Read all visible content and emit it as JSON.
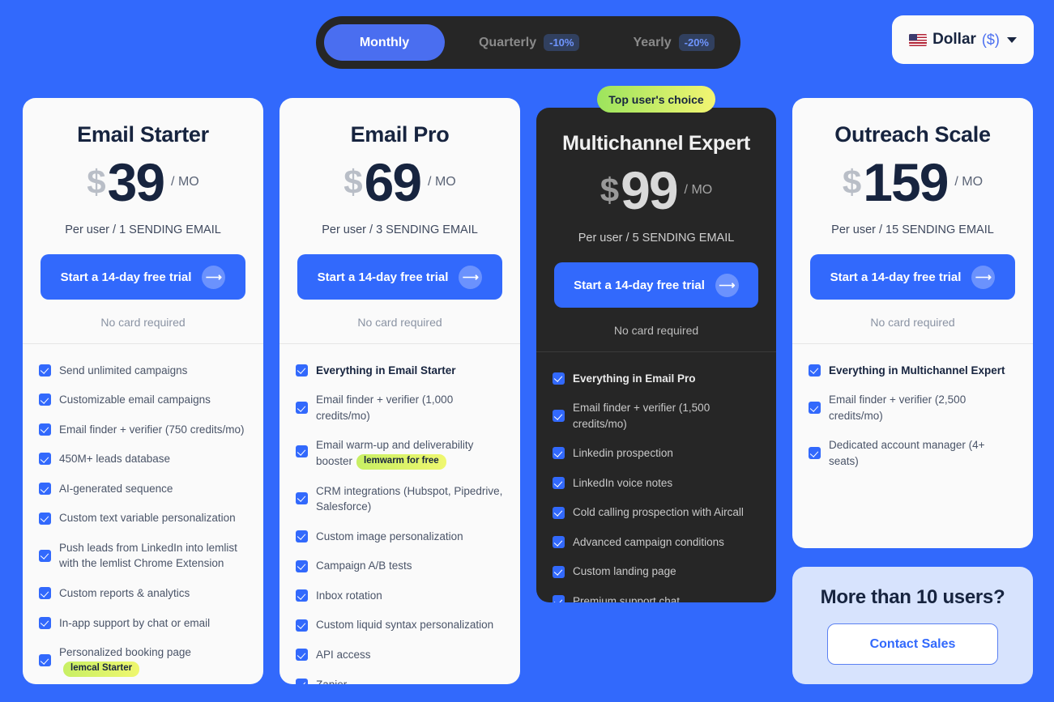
{
  "theme": {
    "background": "#3269fc",
    "card_bg": "#fafafa",
    "dark_card_bg": "#262626",
    "accent": "#3269fc",
    "badge_gradient_from": "#9ce45d",
    "badge_gradient_to": "#f3f572"
  },
  "billing_toggle": {
    "options": [
      {
        "label": "Monthly",
        "badge": "",
        "active": true
      },
      {
        "label": "Quarterly",
        "badge": "-10%",
        "active": false
      },
      {
        "label": "Yearly",
        "badge": "-20%",
        "active": false
      }
    ]
  },
  "currency_selector": {
    "flag": "us-flag-icon",
    "name": "Dollar",
    "symbol": "($)",
    "caret": "chevron-down-icon"
  },
  "top_choice_badge": "Top user's choice",
  "common": {
    "cta_label": "Start a 14-day free trial",
    "cta_arrow": "arrow-right-icon",
    "no_card": "No card required"
  },
  "plans": [
    {
      "name": "Email Starter",
      "currency_mark": "$",
      "amount": "39",
      "period": "/ MO",
      "subline": "Per user / 1 SENDING EMAIL",
      "cta": "Start a 14-day free trial",
      "no_card": "No card required",
      "features": [
        {
          "text": "Send unlimited campaigns",
          "bold": false,
          "tag": ""
        },
        {
          "text": "Customizable email campaigns",
          "bold": false,
          "tag": ""
        },
        {
          "text": "Email finder + verifier (750 credits/mo)",
          "bold": false,
          "tag": ""
        },
        {
          "text": "450M+ leads database",
          "bold": false,
          "tag": ""
        },
        {
          "text": "AI-generated sequence",
          "bold": false,
          "tag": ""
        },
        {
          "text": "Custom text variable personalization",
          "bold": false,
          "tag": ""
        },
        {
          "text": "Push leads from LinkedIn into lemlist with the lemlist Chrome Extension",
          "bold": false,
          "tag": ""
        },
        {
          "text": "Custom reports & analytics",
          "bold": false,
          "tag": ""
        },
        {
          "text": "In-app support by chat or email",
          "bold": false,
          "tag": ""
        },
        {
          "text": "Personalized booking page",
          "bold": false,
          "tag": "lemcal Starter"
        }
      ]
    },
    {
      "name": "Email Pro",
      "currency_mark": "$",
      "amount": "69",
      "period": "/ MO",
      "subline": "Per user / 3 SENDING EMAIL",
      "cta": "Start a 14-day free trial",
      "no_card": "No card required",
      "features": [
        {
          "text": "Everything in Email Starter",
          "bold": true,
          "tag": ""
        },
        {
          "text": "Email finder + verifier (1,000 credits/mo)",
          "bold": false,
          "tag": ""
        },
        {
          "text": "Email warm-up and deliverability booster",
          "bold": false,
          "tag": "lemwarm for free"
        },
        {
          "text": "CRM integrations (Hubspot, Pipedrive, Salesforce)",
          "bold": false,
          "tag": ""
        },
        {
          "text": "Custom image personalization",
          "bold": false,
          "tag": ""
        },
        {
          "text": "Campaign A/B tests",
          "bold": false,
          "tag": ""
        },
        {
          "text": "Inbox rotation",
          "bold": false,
          "tag": ""
        },
        {
          "text": "Custom liquid syntax personalization",
          "bold": false,
          "tag": ""
        },
        {
          "text": "API access",
          "bold": false,
          "tag": ""
        },
        {
          "text": "Zapier",
          "bold": false,
          "tag": ""
        }
      ]
    },
    {
      "name": "Multichannel Expert",
      "currency_mark": "$",
      "amount": "99",
      "period": "/ MO",
      "subline": "Per user / 5 SENDING EMAIL",
      "cta": "Start a 14-day free trial",
      "no_card": "No card required",
      "highlighted": true,
      "badge": "Top user's choice",
      "features": [
        {
          "text": "Everything in Email Pro",
          "bold": true,
          "tag": ""
        },
        {
          "text": "Email finder + verifier (1,500 credits/mo)",
          "bold": false,
          "tag": ""
        },
        {
          "text": "Linkedin prospection",
          "bold": false,
          "tag": ""
        },
        {
          "text": "LinkedIn voice notes",
          "bold": false,
          "tag": ""
        },
        {
          "text": "Cold calling prospection with Aircall",
          "bold": false,
          "tag": ""
        },
        {
          "text": "Advanced campaign conditions",
          "bold": false,
          "tag": ""
        },
        {
          "text": "Custom landing page",
          "bold": false,
          "tag": ""
        },
        {
          "text": "Premium support chat",
          "bold": false,
          "tag": ""
        }
      ]
    },
    {
      "name": "Outreach Scale",
      "currency_mark": "$",
      "amount": "159",
      "period": "/ MO",
      "subline": "Per user / 15 SENDING EMAIL",
      "cta": "Start a 14-day free trial",
      "no_card": "No card required",
      "features": [
        {
          "text": "Everything in Multichannel Expert",
          "bold": true,
          "tag": ""
        },
        {
          "text": "Email finder + verifier (2,500 credits/mo)",
          "bold": false,
          "tag": ""
        },
        {
          "text": "Dedicated account manager (4+ seats)",
          "bold": false,
          "tag": ""
        }
      ]
    }
  ],
  "contact_box": {
    "title": "More than 10 users?",
    "button": "Contact Sales"
  }
}
